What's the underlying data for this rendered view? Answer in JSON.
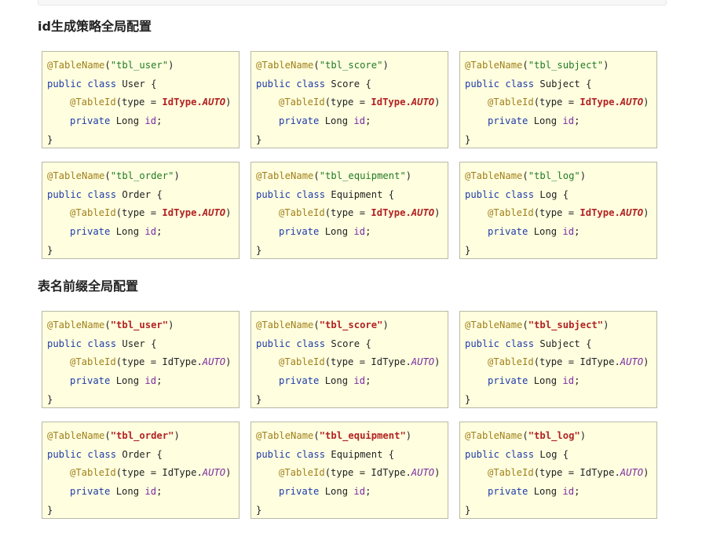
{
  "sections": [
    {
      "title": "id生成策略全局配置",
      "style": "id",
      "cards": [
        {
          "table": "\"tbl_user\"",
          "class_name": "User"
        },
        {
          "table": "\"tbl_score\"",
          "class_name": "Score"
        },
        {
          "table": "\"tbl_subject\"",
          "class_name": "Subject"
        },
        {
          "table": "\"tbl_order\"",
          "class_name": "Order"
        },
        {
          "table": "\"tbl_equipment\"",
          "class_name": "Equipment"
        },
        {
          "table": "\"tbl_log\"",
          "class_name": "Log"
        }
      ]
    },
    {
      "title": "表名前缀全局配置",
      "style": "prefix",
      "cards": [
        {
          "table": "\"tbl_user\"",
          "class_name": "User"
        },
        {
          "table": "\"tbl_score\"",
          "class_name": "Score"
        },
        {
          "table": "\"tbl_subject\"",
          "class_name": "Subject"
        },
        {
          "table": "\"tbl_order\"",
          "class_name": "Order"
        },
        {
          "table": "\"tbl_equipment\"",
          "class_name": "Equipment"
        },
        {
          "table": "\"tbl_log\"",
          "class_name": "Log"
        }
      ]
    }
  ],
  "code": {
    "annotation_table": "@TableName",
    "open_paren": "(",
    "close_paren": ")",
    "kw_public": "public",
    "kw_class": "class",
    "open_brace": "{",
    "annotation_id": "@TableId",
    "type_eq": "(type = ",
    "idtype": "IdType",
    "dot": ".",
    "auto": "AUTO",
    "kw_private": "private",
    "long_type": "Long",
    "field": "id",
    "semicolon": ";",
    "close_brace": "}"
  },
  "colors": {
    "card_bg": "#ffffe0",
    "annotation": "#a07f19",
    "string": "#227a22",
    "string_highlight": "#b22222",
    "keyword": "#1f3aa8",
    "field": "#7a2aa0"
  }
}
